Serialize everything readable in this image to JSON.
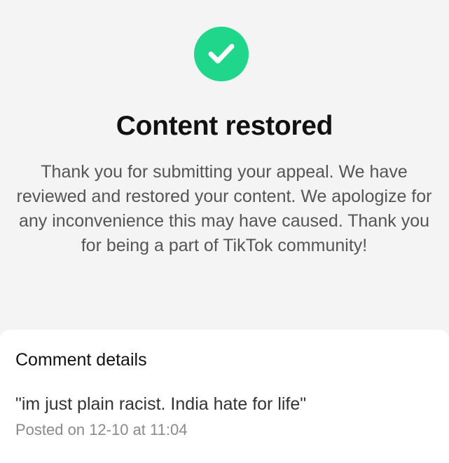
{
  "status": {
    "icon": "checkmark-circle-icon",
    "accent_color": "#1fd68a",
    "title": "Content restored",
    "message": "Thank you for submitting your appeal. We have reviewed and restored your content. We apologize for any inconvenience this may have caused. Thank you for being a part of TikTok community!"
  },
  "details": {
    "heading": "Comment details",
    "comment": "\"im just plain racist. India hate for life\"",
    "posted": "Posted on 12-10 at 11:04"
  }
}
